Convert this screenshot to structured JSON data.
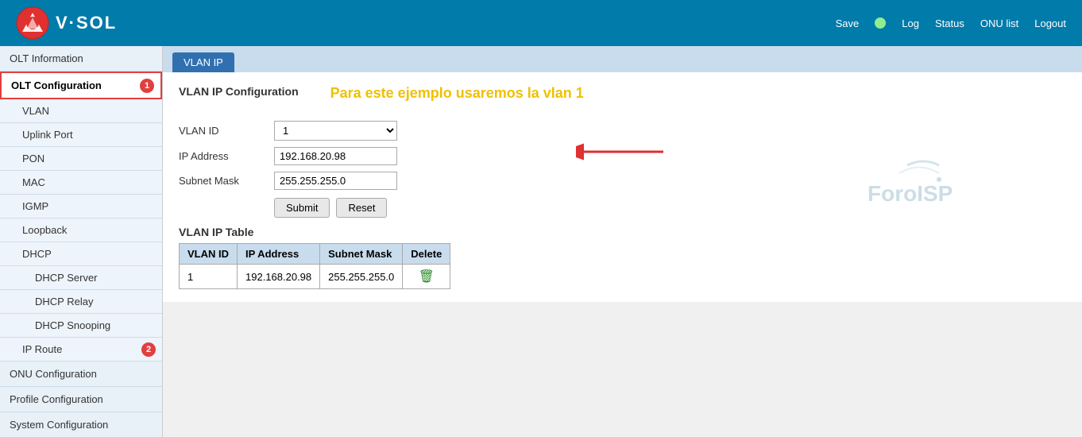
{
  "header": {
    "logo_text": "V·SOL",
    "save_label": "Save",
    "status_color": "#90ee90",
    "nav": {
      "log": "Log",
      "status": "Status",
      "onu_list": "ONU list",
      "logout": "Logout"
    }
  },
  "sidebar": {
    "items": [
      {
        "id": "olt-info",
        "label": "OLT Information",
        "level": 0,
        "state": "normal"
      },
      {
        "id": "olt-config",
        "label": "OLT Configuration",
        "level": 0,
        "state": "active-section",
        "badge": "1"
      },
      {
        "id": "vlan",
        "label": "VLAN",
        "level": 1,
        "state": "normal"
      },
      {
        "id": "uplink-port",
        "label": "Uplink Port",
        "level": 1,
        "state": "normal"
      },
      {
        "id": "pon",
        "label": "PON",
        "level": 1,
        "state": "normal"
      },
      {
        "id": "mac",
        "label": "MAC",
        "level": 1,
        "state": "normal"
      },
      {
        "id": "igmp",
        "label": "IGMP",
        "level": 1,
        "state": "normal"
      },
      {
        "id": "loopback",
        "label": "Loopback",
        "level": 1,
        "state": "normal"
      },
      {
        "id": "dhcp",
        "label": "DHCP",
        "level": 1,
        "state": "normal"
      },
      {
        "id": "dhcp-server",
        "label": "DHCP Server",
        "level": 2,
        "state": "normal"
      },
      {
        "id": "dhcp-relay",
        "label": "DHCP Relay",
        "level": 2,
        "state": "normal"
      },
      {
        "id": "dhcp-snooping",
        "label": "DHCP Snooping",
        "level": 2,
        "state": "normal"
      },
      {
        "id": "ip-route",
        "label": "IP Route",
        "level": 1,
        "state": "active-highlight",
        "badge": "2"
      },
      {
        "id": "onu-config",
        "label": "ONU Configuration",
        "level": 0,
        "state": "normal"
      },
      {
        "id": "profile-config",
        "label": "Profile Configuration",
        "level": 0,
        "state": "normal"
      },
      {
        "id": "system-config",
        "label": "System Configuration",
        "level": 0,
        "state": "normal"
      }
    ]
  },
  "tab": {
    "label": "VLAN IP"
  },
  "main": {
    "section_title": "VLAN IP Configuration",
    "annotation": "Para este ejemplo usaremos la vlan 1",
    "form": {
      "vlan_id_label": "VLAN ID",
      "vlan_id_value": "1",
      "ip_address_label": "IP Address",
      "ip_address_value": "192.168.20.98",
      "subnet_mask_label": "Subnet Mask",
      "subnet_mask_value": "255.255.255.0",
      "submit_label": "Submit",
      "reset_label": "Reset"
    },
    "table": {
      "title": "VLAN IP Table",
      "columns": [
        "VLAN ID",
        "IP Address",
        "Subnet Mask",
        "Delete"
      ],
      "rows": [
        {
          "vlan_id": "1",
          "ip_address": "192.168.20.98",
          "subnet_mask": "255.255.255.0"
        }
      ]
    },
    "watermark": "ForoISP"
  }
}
